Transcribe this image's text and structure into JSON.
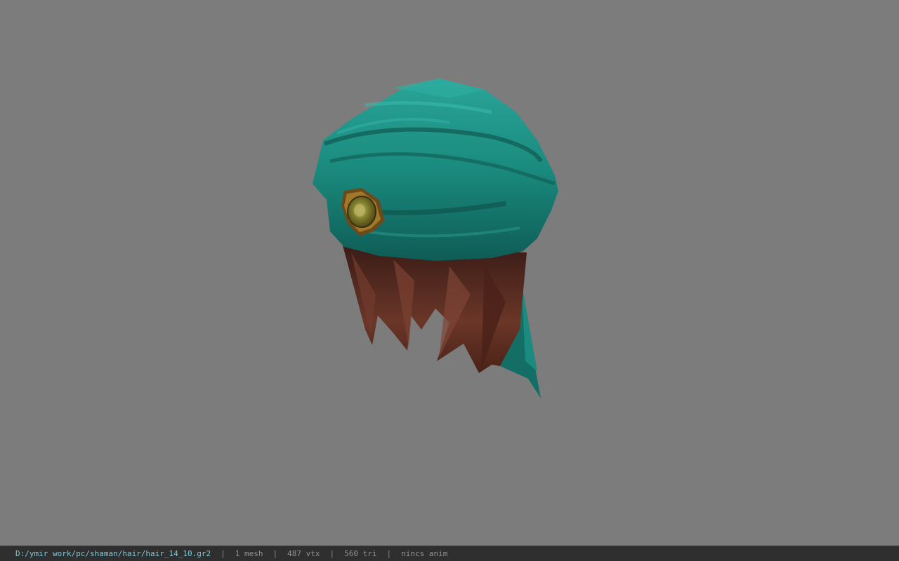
{
  "viewer": {
    "model": "hair_14_10",
    "model_colors": {
      "background": "#7c7c7c",
      "turban": "#1e8c80",
      "turban_dark": "#0f5a52",
      "hair": "#5a2e22",
      "gem": "#8c8a3a"
    }
  },
  "status": {
    "path": "D:/ymir work/pc/shaman/hair/hair_14_10.gr2",
    "sep": "|",
    "mesh": "1 mesh",
    "vtx": "487 vtx",
    "tri": "560 tri",
    "anim": "nincs anim"
  }
}
